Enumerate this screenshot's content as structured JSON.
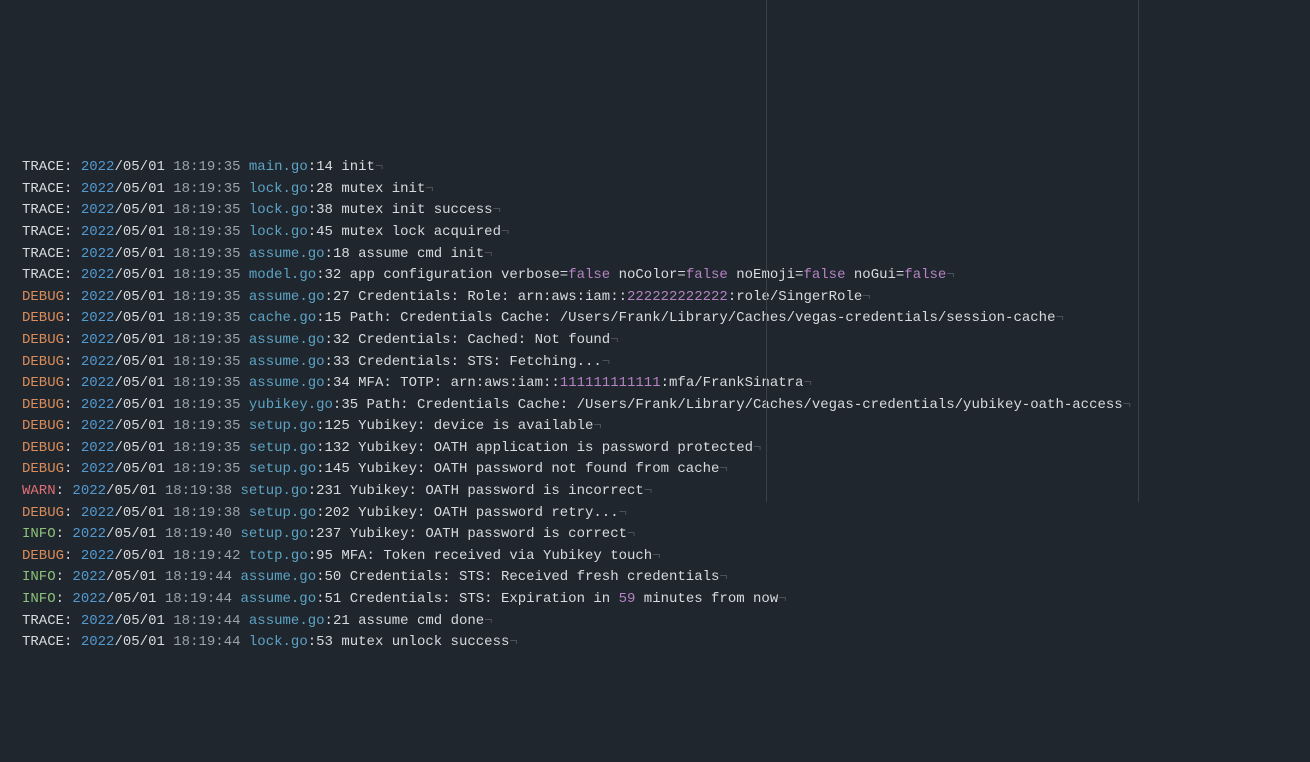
{
  "levelColors": {
    "TRACE": "lvl-trace",
    "DEBUG": "lvl-debug",
    "INFO": "lvl-info",
    "WARN": "lvl-warn"
  },
  "lines": [
    {
      "level": "TRACE",
      "year": "2022",
      "month": "05",
      "day": "01",
      "time": "18:19:35",
      "file": "main.go",
      "line": "14",
      "segments": [
        {
          "t": "init"
        }
      ]
    },
    {
      "level": "TRACE",
      "year": "2022",
      "month": "05",
      "day": "01",
      "time": "18:19:35",
      "file": "lock.go",
      "line": "28",
      "segments": [
        {
          "t": "mutex init"
        }
      ]
    },
    {
      "level": "TRACE",
      "year": "2022",
      "month": "05",
      "day": "01",
      "time": "18:19:35",
      "file": "lock.go",
      "line": "38",
      "segments": [
        {
          "t": "mutex init success"
        }
      ]
    },
    {
      "level": "TRACE",
      "year": "2022",
      "month": "05",
      "day": "01",
      "time": "18:19:35",
      "file": "lock.go",
      "line": "45",
      "segments": [
        {
          "t": "mutex lock acquired"
        }
      ]
    },
    {
      "level": "TRACE",
      "year": "2022",
      "month": "05",
      "day": "01",
      "time": "18:19:35",
      "file": "assume.go",
      "line": "18",
      "segments": [
        {
          "t": "assume cmd init"
        }
      ]
    },
    {
      "level": "TRACE",
      "year": "2022",
      "month": "05",
      "day": "01",
      "time": "18:19:35",
      "file": "model.go",
      "line": "32",
      "segments": [
        {
          "t": "app configuration verbose="
        },
        {
          "t": "false",
          "c": "kw-false"
        },
        {
          "t": " noColor="
        },
        {
          "t": "false",
          "c": "kw-false"
        },
        {
          "t": " noEmoji="
        },
        {
          "t": "false",
          "c": "kw-false"
        },
        {
          "t": " noGui="
        },
        {
          "t": "false",
          "c": "kw-false"
        }
      ]
    },
    {
      "level": "DEBUG",
      "year": "2022",
      "month": "05",
      "day": "01",
      "time": "18:19:35",
      "file": "assume.go",
      "line": "27",
      "segments": [
        {
          "t": "Credentials: Role: arn:aws:iam::"
        },
        {
          "t": "222222222222",
          "c": "kw-num"
        },
        {
          "t": ":role/SingerRole"
        }
      ]
    },
    {
      "level": "DEBUG",
      "year": "2022",
      "month": "05",
      "day": "01",
      "time": "18:19:35",
      "file": "cache.go",
      "line": "15",
      "segments": [
        {
          "t": "Path: Credentials Cache: /Users/Frank/Library/Caches/vegas-credentials/session-cache"
        }
      ]
    },
    {
      "level": "DEBUG",
      "year": "2022",
      "month": "05",
      "day": "01",
      "time": "18:19:35",
      "file": "assume.go",
      "line": "32",
      "segments": [
        {
          "t": "Credentials: Cached: Not found"
        }
      ]
    },
    {
      "level": "DEBUG",
      "year": "2022",
      "month": "05",
      "day": "01",
      "time": "18:19:35",
      "file": "assume.go",
      "line": "33",
      "segments": [
        {
          "t": "Credentials: STS: Fetching..."
        }
      ]
    },
    {
      "level": "DEBUG",
      "year": "2022",
      "month": "05",
      "day": "01",
      "time": "18:19:35",
      "file": "assume.go",
      "line": "34",
      "segments": [
        {
          "t": "MFA: TOTP: arn:aws:iam::"
        },
        {
          "t": "111111111111",
          "c": "kw-num"
        },
        {
          "t": ":mfa/FrankSinatra"
        }
      ]
    },
    {
      "level": "DEBUG",
      "year": "2022",
      "month": "05",
      "day": "01",
      "time": "18:19:35",
      "file": "yubikey.go",
      "line": "35",
      "segments": [
        {
          "t": "Path: Credentials Cache: /Users/Frank/Library/Caches/vegas-credentials/yubikey-oath-access"
        }
      ]
    },
    {
      "level": "DEBUG",
      "year": "2022",
      "month": "05",
      "day": "01",
      "time": "18:19:35",
      "file": "setup.go",
      "line": "125",
      "segments": [
        {
          "t": "Yubikey: device is available"
        }
      ]
    },
    {
      "level": "DEBUG",
      "year": "2022",
      "month": "05",
      "day": "01",
      "time": "18:19:35",
      "file": "setup.go",
      "line": "132",
      "segments": [
        {
          "t": "Yubikey: OATH application is password protected"
        }
      ]
    },
    {
      "level": "DEBUG",
      "year": "2022",
      "month": "05",
      "day": "01",
      "time": "18:19:35",
      "file": "setup.go",
      "line": "145",
      "segments": [
        {
          "t": "Yubikey: OATH password not found from cache"
        }
      ]
    },
    {
      "level": "WARN",
      "year": "2022",
      "month": "05",
      "day": "01",
      "time": "18:19:38",
      "file": "setup.go",
      "line": "231",
      "segments": [
        {
          "t": "Yubikey: OATH password is incorrect"
        }
      ]
    },
    {
      "level": "DEBUG",
      "year": "2022",
      "month": "05",
      "day": "01",
      "time": "18:19:38",
      "file": "setup.go",
      "line": "202",
      "segments": [
        {
          "t": "Yubikey: OATH password retry..."
        }
      ]
    },
    {
      "level": "INFO",
      "year": "2022",
      "month": "05",
      "day": "01",
      "time": "18:19:40",
      "file": "setup.go",
      "line": "237",
      "segments": [
        {
          "t": "Yubikey: OATH password is correct"
        }
      ]
    },
    {
      "level": "DEBUG",
      "year": "2022",
      "month": "05",
      "day": "01",
      "time": "18:19:42",
      "file": "totp.go",
      "line": "95",
      "segments": [
        {
          "t": "MFA: Token received via Yubikey touch"
        }
      ]
    },
    {
      "level": "INFO",
      "year": "2022",
      "month": "05",
      "day": "01",
      "time": "18:19:44",
      "file": "assume.go",
      "line": "50",
      "segments": [
        {
          "t": "Credentials: STS: Received fresh credentials"
        }
      ]
    },
    {
      "level": "INFO",
      "year": "2022",
      "month": "05",
      "day": "01",
      "time": "18:19:44",
      "file": "assume.go",
      "line": "51",
      "segments": [
        {
          "t": "Credentials: STS: Expiration in "
        },
        {
          "t": "59",
          "c": "kw-num"
        },
        {
          "t": " minutes from now"
        }
      ]
    },
    {
      "level": "TRACE",
      "year": "2022",
      "month": "05",
      "day": "01",
      "time": "18:19:44",
      "file": "assume.go",
      "line": "21",
      "segments": [
        {
          "t": "assume cmd done"
        }
      ]
    },
    {
      "level": "TRACE",
      "year": "2022",
      "month": "05",
      "day": "01",
      "time": "18:19:44",
      "file": "lock.go",
      "line": "53",
      "segments": [
        {
          "t": "mutex unlock success"
        }
      ]
    }
  ]
}
